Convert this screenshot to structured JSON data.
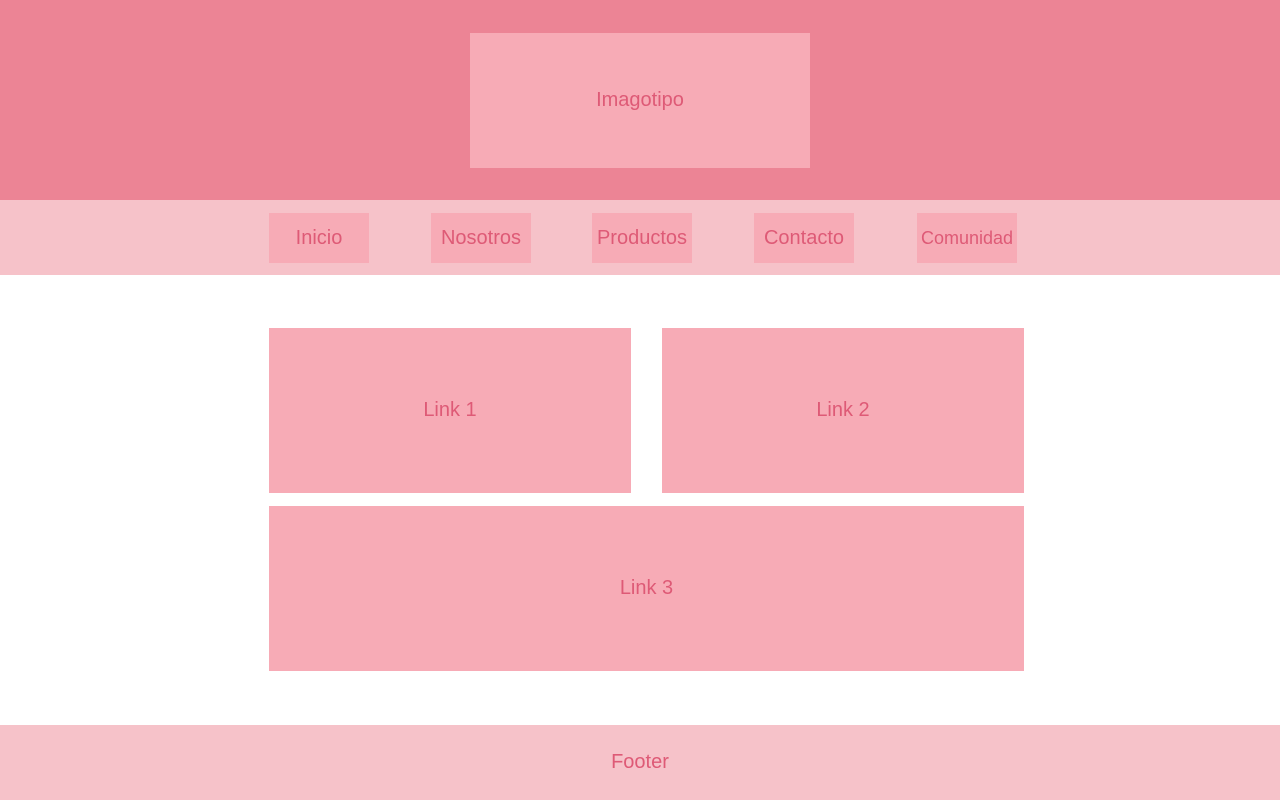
{
  "header": {
    "logo_label": "Imagotipo"
  },
  "nav": {
    "items": [
      {
        "label": "Inicio"
      },
      {
        "label": "Nosotros"
      },
      {
        "label": "Productos"
      },
      {
        "label": "Contacto"
      },
      {
        "label": "Comunidad"
      }
    ]
  },
  "main": {
    "links": [
      {
        "label": "Link 1"
      },
      {
        "label": "Link 2"
      },
      {
        "label": "Link 3"
      }
    ]
  },
  "footer": {
    "label": "Footer"
  },
  "colors": {
    "header_bg": "#ec8495",
    "nav_bg": "#f6c2c9",
    "box_bg": "#f7abb6",
    "text": "#de5a76",
    "page_bg": "#ffffff"
  }
}
